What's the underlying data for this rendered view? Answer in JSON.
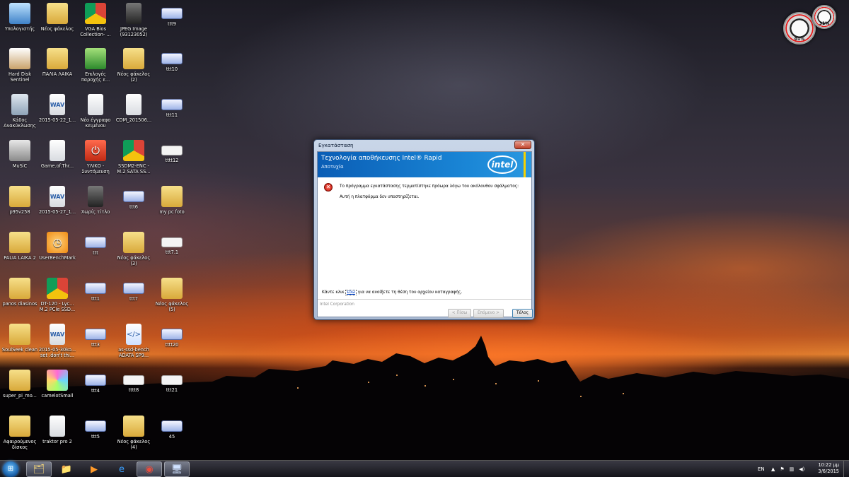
{
  "desktop": {
    "icons": [
      {
        "label": "Υπολογιστής",
        "icon": "computer-icon"
      },
      {
        "label": "Νέος φάκελος",
        "icon": "folder-icon"
      },
      {
        "label": "VGA Bios\nCollection- ...",
        "icon": "chrome-icon"
      },
      {
        "label": "JPEG Image\n(93123052)",
        "icon": "image-icon"
      },
      {
        "label": "ttt9",
        "icon": "screenshot-icon"
      },
      {
        "label": "Hard Disk\nSentinel",
        "icon": "hard-disk-icon"
      },
      {
        "label": "ΠΑΛΙΑ ΛΑΙΚΑ",
        "icon": "folder-icon"
      },
      {
        "label": "Επιλογές\nπαροχής ε...",
        "icon": "program-icon"
      },
      {
        "label": "Νέος φάκελος\n(2)",
        "icon": "folder-icon"
      },
      {
        "label": "ttt10",
        "icon": "screenshot-icon"
      },
      {
        "label": "Κάδος\nΑνακύκλωσης",
        "icon": "recycle-bin-icon"
      },
      {
        "label": "2015-05-22_1...",
        "icon": "wav-icon"
      },
      {
        "label": "Νέο έγγραφο\nκειμένου",
        "icon": "document-icon"
      },
      {
        "label": "CDM_201506...",
        "icon": "document-icon"
      },
      {
        "label": "ttt11",
        "icon": "screenshot-icon"
      },
      {
        "label": "MuSiC",
        "icon": "speaker-icon"
      },
      {
        "label": "Game.of.Thr...",
        "icon": "document-icon"
      },
      {
        "label": "ΥΛΙΚΟ -\nΣυντόμευση",
        "icon": "power-icon"
      },
      {
        "label": "SSDM2-ENC -\nM.2 SATA SS...",
        "icon": "chrome-icon"
      },
      {
        "label": "tttt12",
        "icon": "blank-image-icon"
      },
      {
        "label": "p95v258",
        "icon": "folder-icon"
      },
      {
        "label": "2015-05-27_1...",
        "icon": "wav-icon"
      },
      {
        "label": "Χωρίς τίτλο",
        "icon": "image-icon"
      },
      {
        "label": "ttt6",
        "icon": "screenshot-icon"
      },
      {
        "label": "my pc foto",
        "icon": "folder-icon"
      },
      {
        "label": "PALIA LAIKA 2",
        "icon": "folder-icon"
      },
      {
        "label": "UserBenchMark",
        "icon": "benchmark-icon"
      },
      {
        "label": "ttt",
        "icon": "screenshot-icon"
      },
      {
        "label": "Νέος φάκελος\n(3)",
        "icon": "folder-icon"
      },
      {
        "label": "ttt7.1",
        "icon": "blank-image-icon"
      },
      {
        "label": "panos diasinos",
        "icon": "folder-icon"
      },
      {
        "label": "DT-120 - Lyc...\nM.2 PCIe SSD...",
        "icon": "chrome-icon"
      },
      {
        "label": "ttt1",
        "icon": "screenshot-icon"
      },
      {
        "label": "ttt7",
        "icon": "screenshot-icon"
      },
      {
        "label": "Νέος φάκελος\n(5)",
        "icon": "folder-icon"
      },
      {
        "label": "SoulSeek clean",
        "icon": "folder-icon"
      },
      {
        "label": "2015-05-30ko...\nset .don't thi...",
        "icon": "wav-icon"
      },
      {
        "label": "ttt3",
        "icon": "screenshot-icon"
      },
      {
        "label": "as-ssd-bench\nADATA SP9...",
        "icon": "html-icon"
      },
      {
        "label": "tttt20",
        "icon": "screenshot-icon"
      },
      {
        "label": "super_pi_mo...",
        "icon": "folder-icon"
      },
      {
        "label": "camelotSmall",
        "icon": "disc-icon"
      },
      {
        "label": "ttt4",
        "icon": "screenshot-icon"
      },
      {
        "label": "tttt8",
        "icon": "blank-image-icon"
      },
      {
        "label": "ttt21",
        "icon": "blank-image-icon"
      },
      {
        "label": "Αφαιρούμενος\nδίσκος",
        "icon": "folder-icon"
      },
      {
        "label": "traktor pro 2",
        "icon": "document-icon"
      },
      {
        "label": "ttt5",
        "icon": "screenshot-icon"
      },
      {
        "label": "Νέος φάκελος\n(4)",
        "icon": "folder-icon"
      },
      {
        "label": "45",
        "icon": "screenshot-icon"
      }
    ]
  },
  "gadgets": {
    "cpu_meter": {
      "cpu_value": "01%",
      "memory_value": "31%"
    }
  },
  "dialog": {
    "window_title": "Εγκατάσταση",
    "close_label": "✕",
    "banner_title": "Τεχνολογία αποθήκευσης Intel® Rapid",
    "banner_subtitle": "Αποτυχία",
    "logo_text": "intel",
    "error_message": "Το πρόγραμμα εγκατάστασης τερματίστηκε πρόωρα λόγω του ακόλουθου σφάλματος:",
    "error_detail": "Αυτή η πλατφόρμα δεν υποστηρίζεται.",
    "log_prefix": "Κάντε κλικ",
    "log_link": "εδώ",
    "log_suffix": "για να ανοίξετε τη θέση του αρχείου καταγραφής.",
    "footer_brand": "Intel Corporation",
    "back_button": "< Πίσω",
    "next_button": "Επόμενο >",
    "finish_button": "Τέλος"
  },
  "taskbar": {
    "start_label": "⊞",
    "items": [
      {
        "name": "explorer",
        "icon": "explorer-icon",
        "active": true
      },
      {
        "name": "libraries",
        "icon": "folder-icon",
        "active": false
      },
      {
        "name": "media-player",
        "icon": "media-player-icon",
        "active": false
      },
      {
        "name": "internet-explorer",
        "icon": "internet-explorer-icon",
        "active": false
      },
      {
        "name": "chrome",
        "icon": "chrome-icon",
        "active": true
      },
      {
        "name": "installer",
        "icon": "installer-icon",
        "active": true
      }
    ],
    "language": "EN",
    "time": "10:22 μμ",
    "date": "3/6/2015"
  }
}
